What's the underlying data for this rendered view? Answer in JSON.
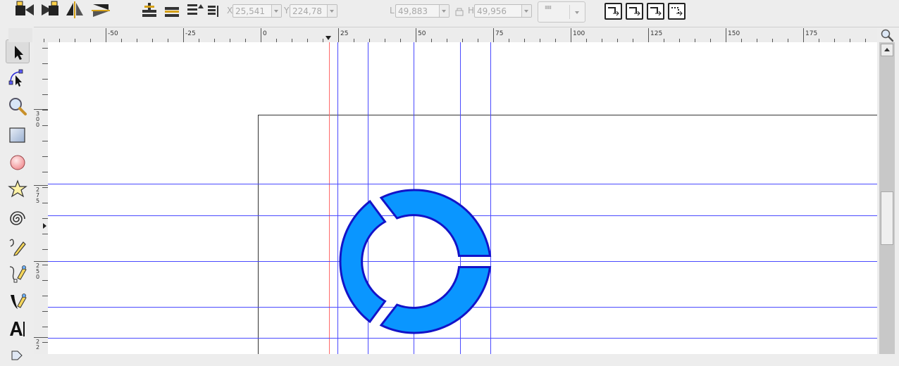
{
  "controls": {
    "x_label": "X",
    "x_value": "25,541",
    "y_label": "Y",
    "y_value": "224,78",
    "w_label": "L",
    "w_value": "49,883",
    "h_label": "H",
    "h_value": "49,956",
    "units_value": "ıııııı"
  },
  "ruler": {
    "h_labels": [
      "-50",
      "-25",
      "0",
      "25",
      "50",
      "75",
      "100",
      "125",
      "150",
      "175"
    ],
    "v_labels": [
      "3\n0\n0",
      "2\n7\n5",
      "2\n5\n0",
      "2\n2"
    ]
  },
  "tools": [
    "selector-tool",
    "node-tool",
    "zoom-tool",
    "rectangle-tool",
    "ellipse-tool",
    "star-tool",
    "spiral-tool",
    "pencil-tool",
    "pen-tool",
    "calligraphy-tool",
    "text-tool",
    "gradient-tool"
  ],
  "colors": {
    "shape_fill": "#0a96ff",
    "shape_stroke": "#1313c8",
    "guide": "#4040ff",
    "page_border": "#333333",
    "origin_guide": "#ff6060"
  }
}
